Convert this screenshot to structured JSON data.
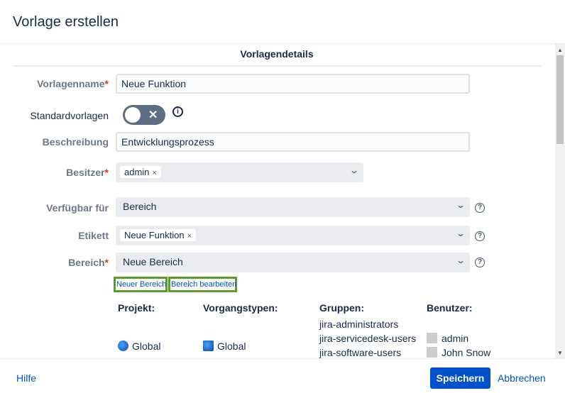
{
  "dialog": {
    "title": "Vorlage erstellen"
  },
  "section": {
    "title": "Vorlagendetails"
  },
  "form": {
    "name": {
      "label": "Vorlagenname",
      "required": "*",
      "value": "Neue Funktion"
    },
    "default": {
      "label": "Standardvorlagen",
      "toggle_state": "off",
      "info": "i"
    },
    "description": {
      "label": "Beschreibung",
      "value": "Entwicklungsprozess"
    },
    "owner": {
      "label": "Besitzer",
      "required": "*",
      "tag": "admin",
      "remove": "×"
    },
    "available": {
      "label": "Verfügbar für",
      "value": "Bereich",
      "help": "?"
    },
    "label": {
      "label": "Etikett",
      "tag": "Neue Funktion",
      "remove": "×",
      "help": "?"
    },
    "scope": {
      "label": "Bereich",
      "required": "*",
      "value": "Neue Bereich",
      "help": "?"
    }
  },
  "links": {
    "new_scope": "Neuer Bereich",
    "edit_scope": "Bereich bearbeiten"
  },
  "scope_table": {
    "headers": {
      "project": "Projekt:",
      "issue_types": "Vorgangstypen:",
      "groups": "Gruppen:",
      "users": "Benutzer:"
    },
    "project": "Global",
    "issue_types": "Global",
    "groups": [
      "jira-administrators",
      "jira-servicedesk-users",
      "jira-software-users"
    ],
    "users": [
      "admin",
      "John Snow"
    ]
  },
  "footer": {
    "help": "Hilfe",
    "save": "Speichern",
    "cancel": "Abbrechen"
  },
  "colors": {
    "primary": "#0052cc",
    "highlight": "#5b9d28"
  }
}
